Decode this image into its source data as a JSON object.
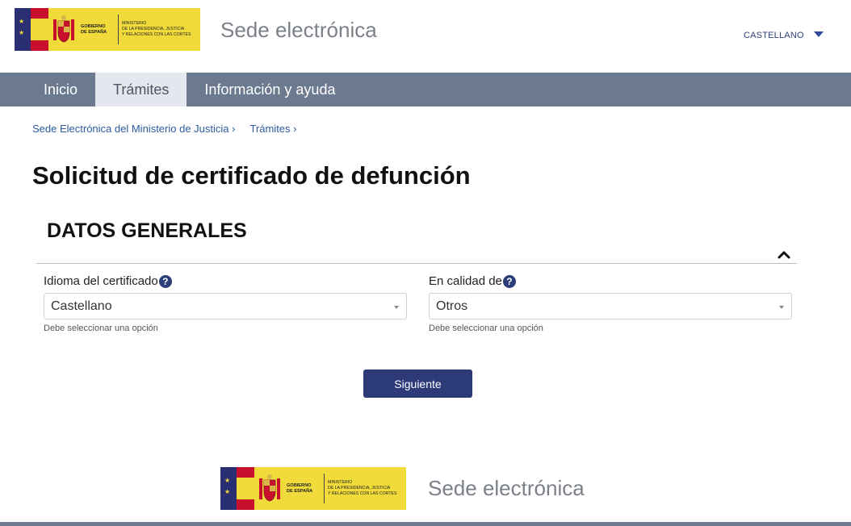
{
  "header": {
    "logo": {
      "gov_line1": "GOBIERNO",
      "gov_line2": "DE ESPAÑA",
      "ministry_line1": "MINISTERIO",
      "ministry_line2": "DE LA PRESIDENCIA, JUSTICIA",
      "ministry_line3": "Y RELACIONES CON LAS CORTES"
    },
    "site_title": "Sede electrónica",
    "language": "CASTELLANO"
  },
  "nav": {
    "items": [
      {
        "label": "Inicio",
        "active": false
      },
      {
        "label": "Trámites",
        "active": true
      },
      {
        "label": "Información y ayuda",
        "active": false
      }
    ]
  },
  "breadcrumb": [
    "Sede Electrónica del Ministerio de Justicia ›",
    "Trámites ›"
  ],
  "page": {
    "title": "Solicitud de certificado de defunción",
    "section_title": "DATOS GENERALES"
  },
  "form": {
    "language_field": {
      "label": "Idioma del certificado",
      "value": "Castellano",
      "hint": "Debe seleccionar una opción"
    },
    "capacity_field": {
      "label": "En calidad de",
      "value": "Otros",
      "hint": "Debe seleccionar una opción"
    },
    "help_glyph": "?",
    "next_button": "Siguiente"
  },
  "footer": {
    "site_title": "Sede electrónica"
  },
  "colors": {
    "nav_bg": "#6b7a8f",
    "nav_active_bg": "#e4e8ee",
    "primary_button": "#2c3a78",
    "link": "#2c5aa0",
    "logo_yellow": "#f0db3a"
  }
}
